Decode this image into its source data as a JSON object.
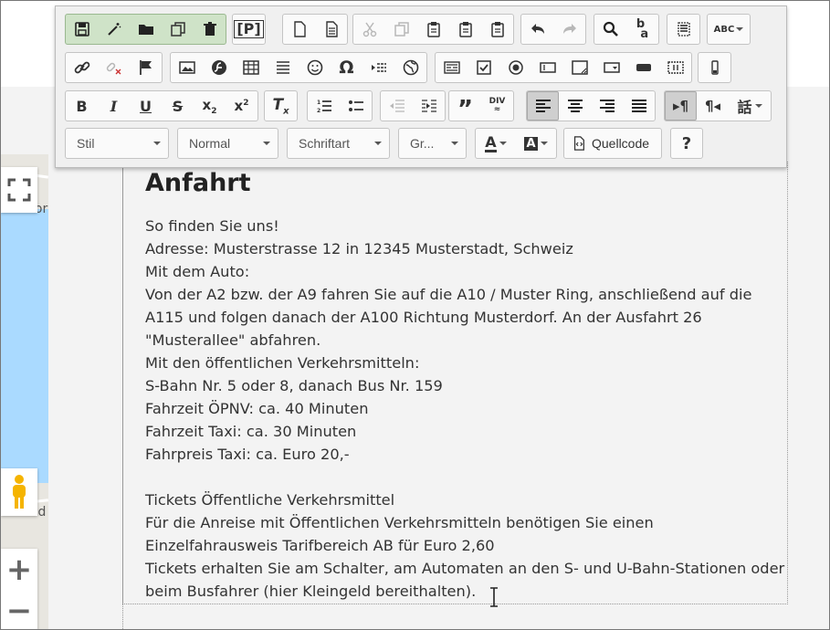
{
  "toolbar": {
    "rows": [
      {
        "groups": [
          {
            "green": true,
            "buttons": [
              {
                "name": "save-icon",
                "glyph": "save"
              },
              {
                "name": "magic-wand-icon",
                "glyph": "wand"
              },
              {
                "name": "folder-icon",
                "glyph": "folder"
              },
              {
                "name": "copy-template-icon",
                "glyph": "copy"
              },
              {
                "name": "trash-icon",
                "glyph": "trash"
              }
            ]
          },
          {
            "buttons": [
              {
                "name": "placeholder-icon",
                "glyph": "placeholder"
              }
            ]
          },
          {
            "buttons": [
              {
                "name": "new-page-icon",
                "glyph": "page"
              },
              {
                "name": "preview-icon",
                "glyph": "doc"
              }
            ]
          },
          {
            "buttons": [
              {
                "name": "cut-icon",
                "glyph": "cut",
                "dim": true
              },
              {
                "name": "copy-icon",
                "glyph": "copy",
                "dim": true
              },
              {
                "name": "paste-icon",
                "glyph": "paste"
              },
              {
                "name": "paste-text-icon",
                "glyph": "paste"
              },
              {
                "name": "paste-word-icon",
                "glyph": "paste"
              }
            ]
          },
          {
            "buttons": [
              {
                "name": "undo-icon",
                "glyph": "undo"
              },
              {
                "name": "redo-icon",
                "glyph": "redo",
                "dim": true
              }
            ]
          },
          {
            "buttons": [
              {
                "name": "find-icon",
                "glyph": "search"
              },
              {
                "name": "replace-icon",
                "glyph": "replace"
              }
            ]
          },
          {
            "buttons": [
              {
                "name": "select-all-icon",
                "glyph": "selectall"
              }
            ]
          },
          {
            "buttons": [
              {
                "name": "spellcheck-icon",
                "glyph": "abc",
                "caret": true
              }
            ]
          }
        ]
      },
      {
        "groups": [
          {
            "buttons": [
              {
                "name": "link-icon",
                "glyph": "link"
              },
              {
                "name": "unlink-icon",
                "glyph": "unlink",
                "dim": true
              },
              {
                "name": "anchor-flag-icon",
                "glyph": "flag"
              }
            ]
          },
          {
            "buttons": [
              {
                "name": "image-icon",
                "glyph": "image"
              },
              {
                "name": "flash-icon",
                "glyph": "flash"
              },
              {
                "name": "table-icon",
                "glyph": "table"
              },
              {
                "name": "horizontal-line-icon",
                "glyph": "hr"
              },
              {
                "name": "smiley-icon",
                "glyph": "smiley"
              },
              {
                "name": "special-char-icon",
                "glyph": "omega"
              },
              {
                "name": "page-break-icon",
                "glyph": "pagebreak"
              },
              {
                "name": "iframe-icon",
                "glyph": "globe"
              }
            ]
          },
          {
            "buttons": [
              {
                "name": "form-icon",
                "glyph": "form"
              },
              {
                "name": "checkbox-icon",
                "glyph": "checkbox"
              },
              {
                "name": "radio-icon",
                "glyph": "radio"
              },
              {
                "name": "textfield-icon",
                "glyph": "textfield"
              },
              {
                "name": "textarea-icon",
                "glyph": "textarea"
              },
              {
                "name": "select-field-icon",
                "glyph": "selectfield"
              },
              {
                "name": "button-field-icon",
                "glyph": "buttonfield"
              },
              {
                "name": "hidden-field-icon",
                "glyph": "hiddenfield"
              }
            ]
          },
          {
            "buttons": [
              {
                "name": "image-button-icon",
                "glyph": "imgbtn"
              }
            ]
          }
        ]
      },
      {
        "groups": [
          {
            "buttons": [
              {
                "name": "bold-icon",
                "glyph": "B"
              },
              {
                "name": "italic-icon",
                "glyph": "I"
              },
              {
                "name": "underline-icon",
                "glyph": "U"
              },
              {
                "name": "strike-icon",
                "glyph": "S"
              },
              {
                "name": "subscript-icon",
                "glyph": "sub"
              },
              {
                "name": "superscript-icon",
                "glyph": "sup"
              }
            ]
          },
          {
            "buttons": [
              {
                "name": "remove-format-icon",
                "glyph": "Tx"
              }
            ]
          },
          {
            "buttons": [
              {
                "name": "numbered-list-icon",
                "glyph": "ol"
              },
              {
                "name": "bullet-list-icon",
                "glyph": "ul"
              }
            ]
          },
          {
            "buttons": [
              {
                "name": "outdent-icon",
                "glyph": "outdent",
                "dim": true
              },
              {
                "name": "indent-icon",
                "glyph": "indent"
              }
            ]
          },
          {
            "buttons": [
              {
                "name": "blockquote-icon",
                "glyph": "quote"
              },
              {
                "name": "div-container-icon",
                "glyph": "div"
              }
            ]
          },
          {
            "buttons": [
              {
                "name": "align-left-icon",
                "glyph": "alignleft",
                "on": true
              },
              {
                "name": "align-center-icon",
                "glyph": "aligncenter"
              },
              {
                "name": "align-right-icon",
                "glyph": "alignright"
              },
              {
                "name": "justify-icon",
                "glyph": "justify"
              }
            ]
          },
          {
            "buttons": [
              {
                "name": "ltr-icon",
                "glyph": "ltr",
                "on": true
              },
              {
                "name": "rtl-icon",
                "glyph": "rtl"
              },
              {
                "name": "language-icon",
                "glyph": "lang",
                "caret": true
              }
            ]
          }
        ]
      }
    ],
    "dropdowns": {
      "style_label": "Stil",
      "format_label": "Normal",
      "font_label": "Schriftart",
      "size_label": "Gr..."
    },
    "source_label": "Quellcode",
    "help_label": "?"
  },
  "content": {
    "heading": "Anfahrt",
    "lines": [
      "So finden Sie uns!",
      "Adresse: Musterstrasse 12 in 12345 Musterstadt, Schweiz",
      "Mit dem Auto:",
      "Von der A2 bzw. der A9 fahren Sie auf die A10 / Muster Ring, anschließend auf die",
      "A115 und folgen danach der A100 Richtung Musterdorf. An der Ausfahrt 26",
      "\"Musterallee\" abfahren.",
      "Mit den öffentlichen Verkehrsmitteln:",
      "S-Bahn Nr. 5 oder 8, danach Bus Nr. 159",
      "Fahrzeit ÖPNV: ca. 40 Minuten",
      "Fahrzeit Taxi: ca. 30 Minuten",
      "Fahrpreis Taxi: ca. Euro 20,-",
      "",
      "Tickets Öffentliche Verkehrsmittel",
      "Für die Anreise mit Öffentlichen Verkehrsmitteln benötigen Sie einen",
      "Einzelfahrausweis Tarifbereich AB für Euro 2,60",
      "Tickets erhalten Sie am Schalter, am Automaten an den S- und U-Bahn-Stationen oder",
      "beim Busfahrer (hier Kleingeld bereithalten)."
    ]
  },
  "map": {
    "label_top": "Sor",
    "label_bottom": "Altend",
    "zoom_in": "+",
    "zoom_out": "−"
  },
  "colors": {
    "toolbar_bg": "#f0f0f0",
    "green_group": "#cfe3c8",
    "text": "#333333",
    "water": "#aadaff"
  }
}
